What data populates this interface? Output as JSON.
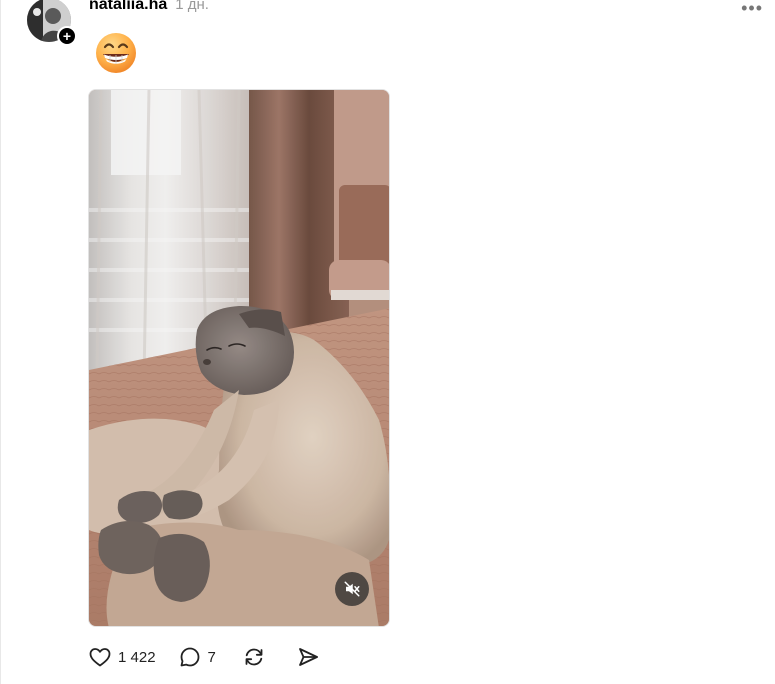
{
  "post": {
    "username": "nataliia.ha",
    "time": "1 дн.",
    "caption_emoji": "😁",
    "follow_symbol": "+",
    "more_symbol": "•••",
    "media": {
      "type": "video",
      "muted": true
    },
    "actions": {
      "likes": "1 422",
      "comments": "7"
    }
  },
  "icons": {
    "follow": "plus-icon",
    "more": "more-horizontal-icon",
    "mute": "speaker-muted-icon",
    "like": "heart-icon",
    "comment": "comment-bubble-icon",
    "repost": "repost-icon",
    "share": "send-icon"
  }
}
